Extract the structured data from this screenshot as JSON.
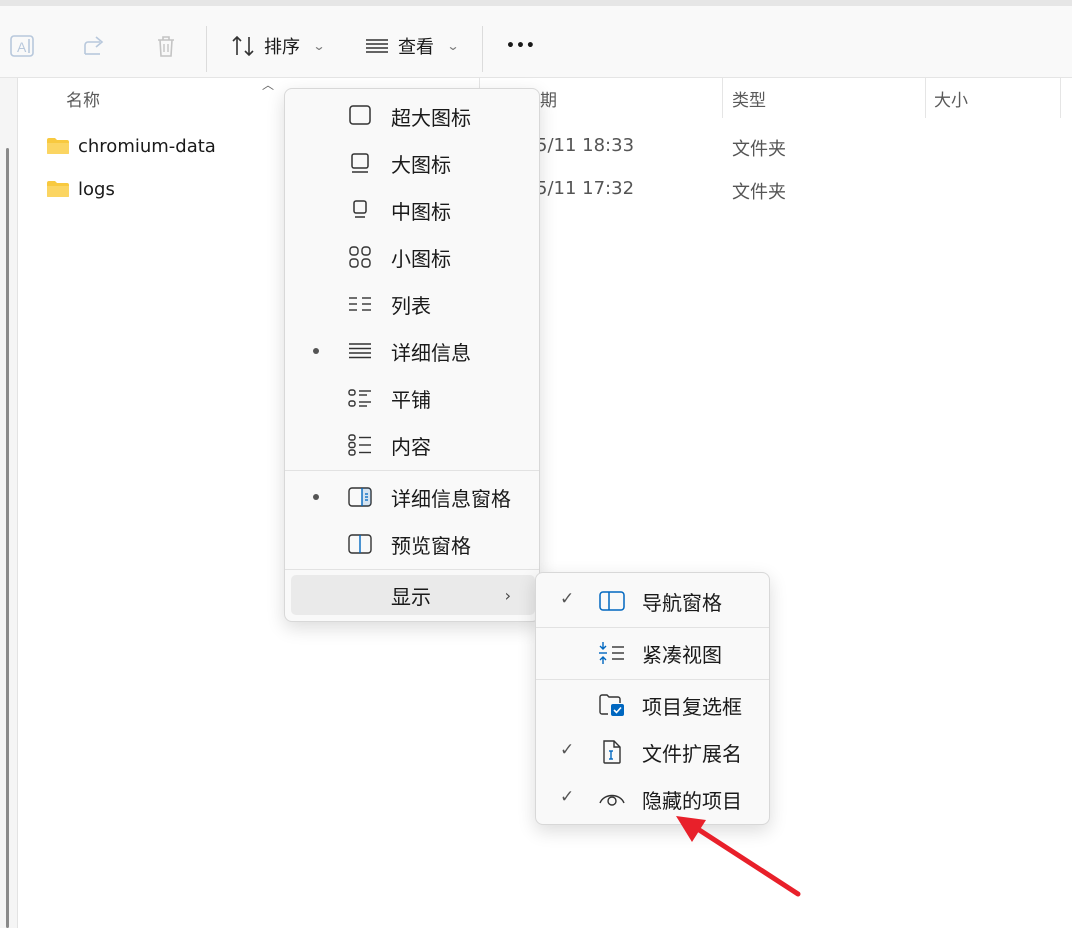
{
  "toolbar": {
    "sort_label": "排序",
    "view_label": "查看",
    "more_label": "•••"
  },
  "columns": {
    "name": "名称",
    "date": "期",
    "type": "类型",
    "size": "大小"
  },
  "files": [
    {
      "name": "chromium-data",
      "date": "5/11 18:33",
      "type": "文件夹"
    },
    {
      "name": "logs",
      "date": "5/11 17:32",
      "type": "文件夹"
    }
  ],
  "view_menu": {
    "items": [
      {
        "label": "超大图标",
        "icon": "extra-large-icons-icon",
        "selected": false
      },
      {
        "label": "大图标",
        "icon": "large-icons-icon",
        "selected": false
      },
      {
        "label": "中图标",
        "icon": "medium-icons-icon",
        "selected": false
      },
      {
        "label": "小图标",
        "icon": "small-icons-icon",
        "selected": false
      },
      {
        "label": "列表",
        "icon": "list-icon",
        "selected": false
      },
      {
        "label": "详细信息",
        "icon": "details-icon",
        "selected": true
      },
      {
        "label": "平铺",
        "icon": "tiles-icon",
        "selected": false
      },
      {
        "label": "内容",
        "icon": "content-icon",
        "selected": false
      }
    ],
    "panes": [
      {
        "label": "详细信息窗格",
        "icon": "details-pane-icon",
        "selected": true
      },
      {
        "label": "预览窗格",
        "icon": "preview-pane-icon",
        "selected": false
      }
    ],
    "show": {
      "label": "显示",
      "arrow": "›"
    }
  },
  "show_submenu": {
    "items": [
      {
        "label": "导航窗格",
        "icon": "navigation-pane-icon",
        "checked": true
      },
      {
        "label": "紧凑视图",
        "icon": "compact-view-icon",
        "checked": false
      },
      {
        "label": "项目复选框",
        "icon": "item-checkbox-icon",
        "checked": false
      },
      {
        "label": "文件扩展名",
        "icon": "file-extension-icon",
        "checked": true
      },
      {
        "label": "隐藏的项目",
        "icon": "hidden-items-icon",
        "checked": true
      }
    ],
    "check_glyph": "✓"
  },
  "colors": {
    "accent": "#0067c0",
    "folder": "#f8c93f",
    "annotation": "#e8202a"
  }
}
